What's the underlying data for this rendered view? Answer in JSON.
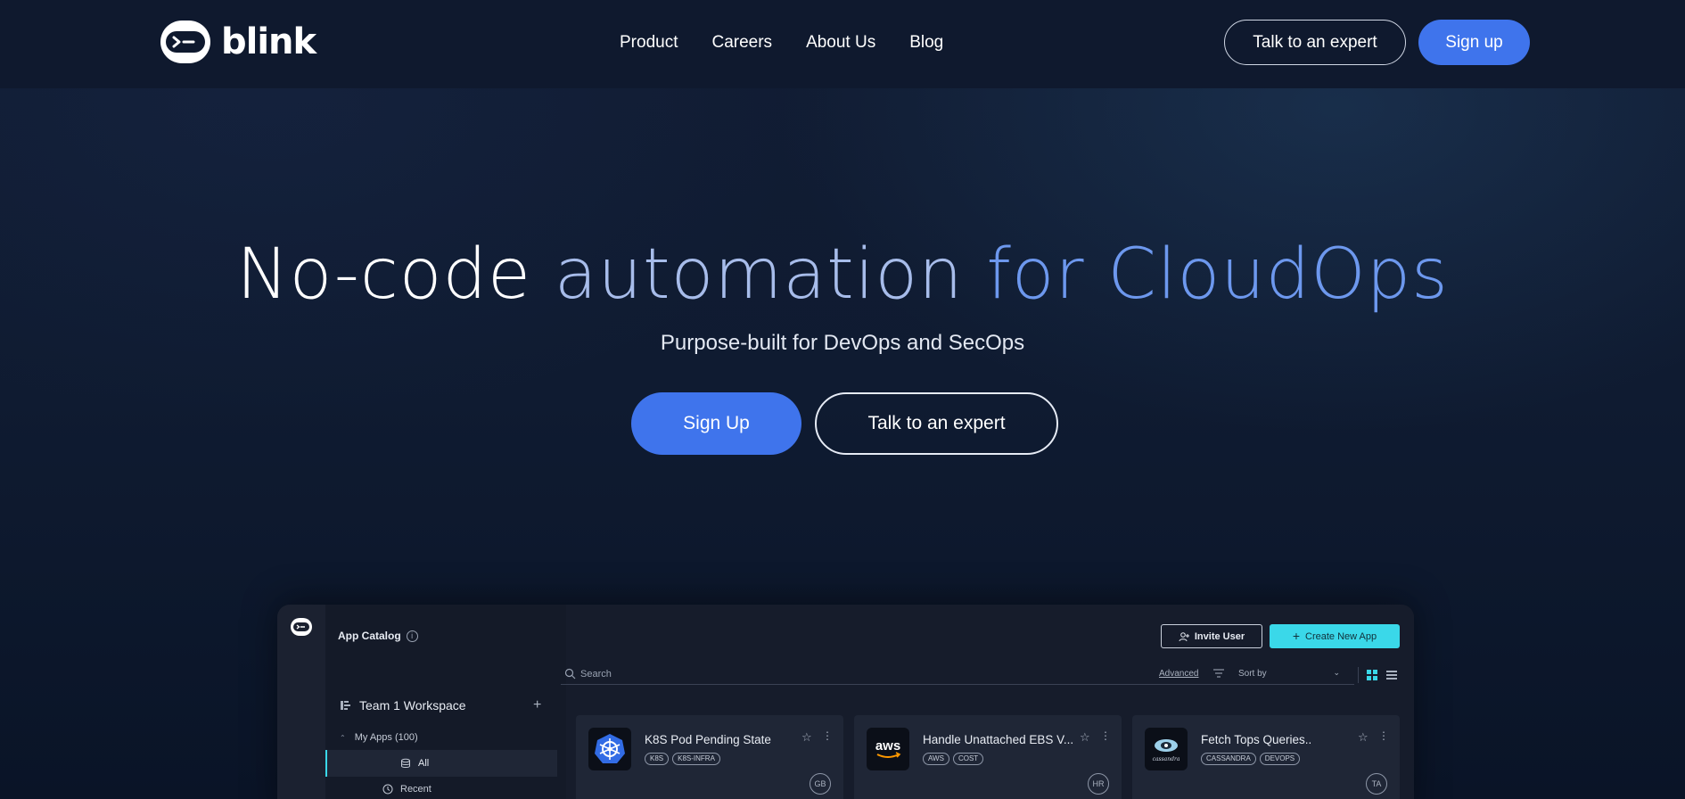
{
  "brand": {
    "name": "blink"
  },
  "nav": {
    "links": [
      "Product",
      "Careers",
      "About Us",
      "Blog"
    ],
    "talk_label": "Talk to an expert",
    "signup_label": "Sign up"
  },
  "hero": {
    "title_part1": "No-code ",
    "title_part2": "automation",
    "title_part3": " for CloudOps",
    "subtitle": "Purpose-built for DevOps and SecOps",
    "signup_label": "Sign Up",
    "talk_label": "Talk to an expert"
  },
  "app": {
    "catalog_title": "App Catalog",
    "invite_label": "Invite User",
    "create_label": "Create New App",
    "search_placeholder": "Search",
    "advanced_label": "Advanced",
    "sort_label": "Sort by",
    "workspace_label": "Team 1 Workspace",
    "my_apps_label": "My Apps (100)",
    "all_label": "All",
    "recent_label": "Recent",
    "cards": [
      {
        "title": "K8S Pod Pending State",
        "tags": [
          "K8S",
          "K8S-INFRA"
        ],
        "avatar": "GB",
        "icon": "kubernetes-icon"
      },
      {
        "title": "Handle Unattached EBS V...",
        "tags": [
          "AWS",
          "COST"
        ],
        "avatar": "HR",
        "icon": "aws-icon"
      },
      {
        "title": "Fetch Tops Queries..",
        "tags": [
          "CASSANDRA",
          "DEVOPS"
        ],
        "avatar": "TA",
        "icon": "cassandra-icon"
      }
    ]
  },
  "colors": {
    "accent": "#3f74ec",
    "title_blue": "#6d98ee",
    "cyan": "#3ad8e9",
    "background": "#0f1a30"
  }
}
